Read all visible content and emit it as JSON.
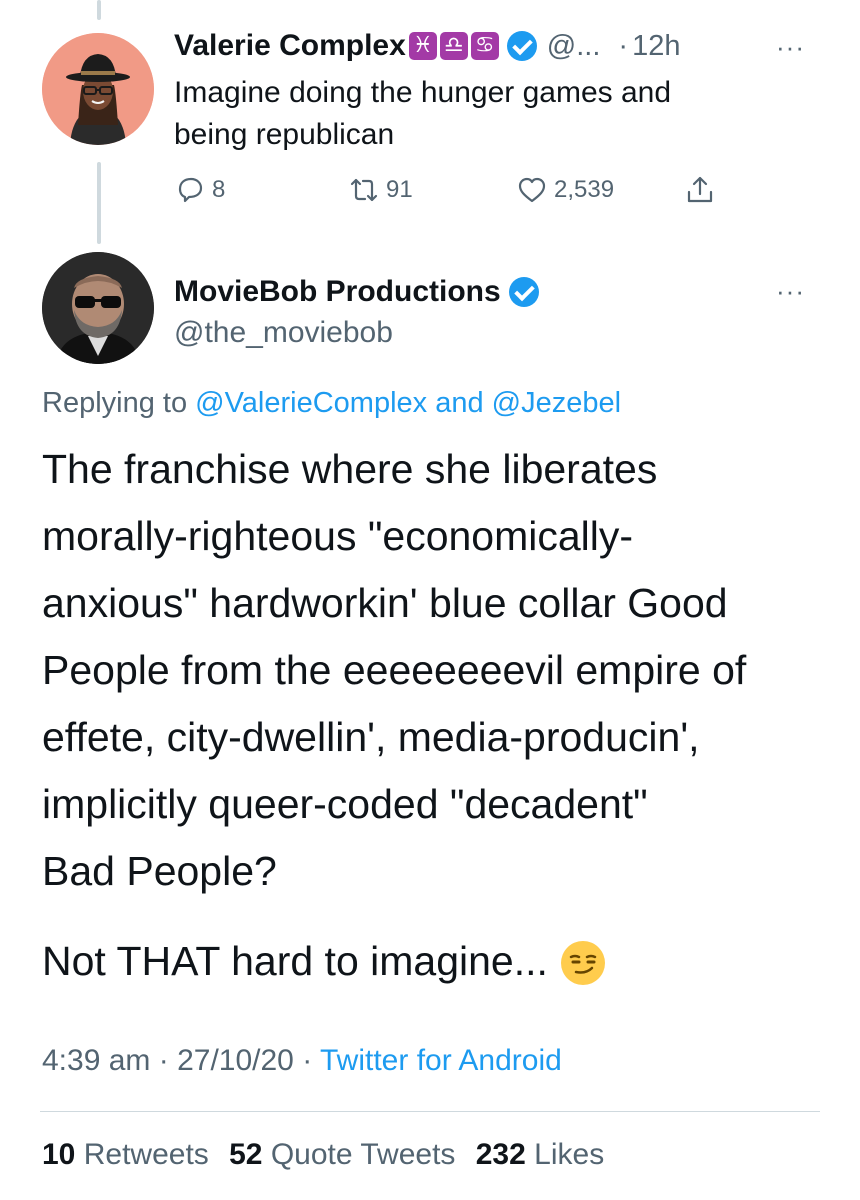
{
  "tweet1": {
    "display_name": "Valerie Complex",
    "zodiac_icons": [
      "♓",
      "♎",
      "♋"
    ],
    "handle": "@...",
    "separator": "·",
    "time": "12h",
    "more": "···",
    "text_lines": [
      "Imagine doing the hunger games and",
      "being republican"
    ],
    "actions": {
      "replies": "8",
      "retweets": "91",
      "likes": "2,539"
    }
  },
  "tweet2": {
    "display_name": "MovieBob Productions",
    "handle": "@the_moviebob",
    "more": "···",
    "replying_prefix": "Replying to",
    "replying_user1": "@ValerieComplex",
    "replying_and": "and",
    "replying_user2": "@Jezebel",
    "body_lines": [
      "The franchise where she liberates",
      "morally-righteous \"economically-",
      "anxious\" hardworkin' blue collar Good",
      "People from the eeeeeeeevil empire of",
      "effete, city-dwellin', media-producin',",
      "implicitly queer-coded \"decadent\"",
      "Bad People?"
    ],
    "closing_line": "Not THAT hard to imagine...",
    "emoji": "😏",
    "timestamp": "4:39 am",
    "date": "27/10/20",
    "source": "Twitter for Android",
    "meta_sep": "·",
    "stats": {
      "retweets_count": "10",
      "retweets_label": "Retweets",
      "quotes_count": "52",
      "quotes_label": "Quote Tweets",
      "likes_count": "232",
      "likes_label": "Likes"
    }
  },
  "colors": {
    "accent": "#1d9bf0",
    "muted": "#536471",
    "zodiac_badge": "#a33aa6"
  }
}
